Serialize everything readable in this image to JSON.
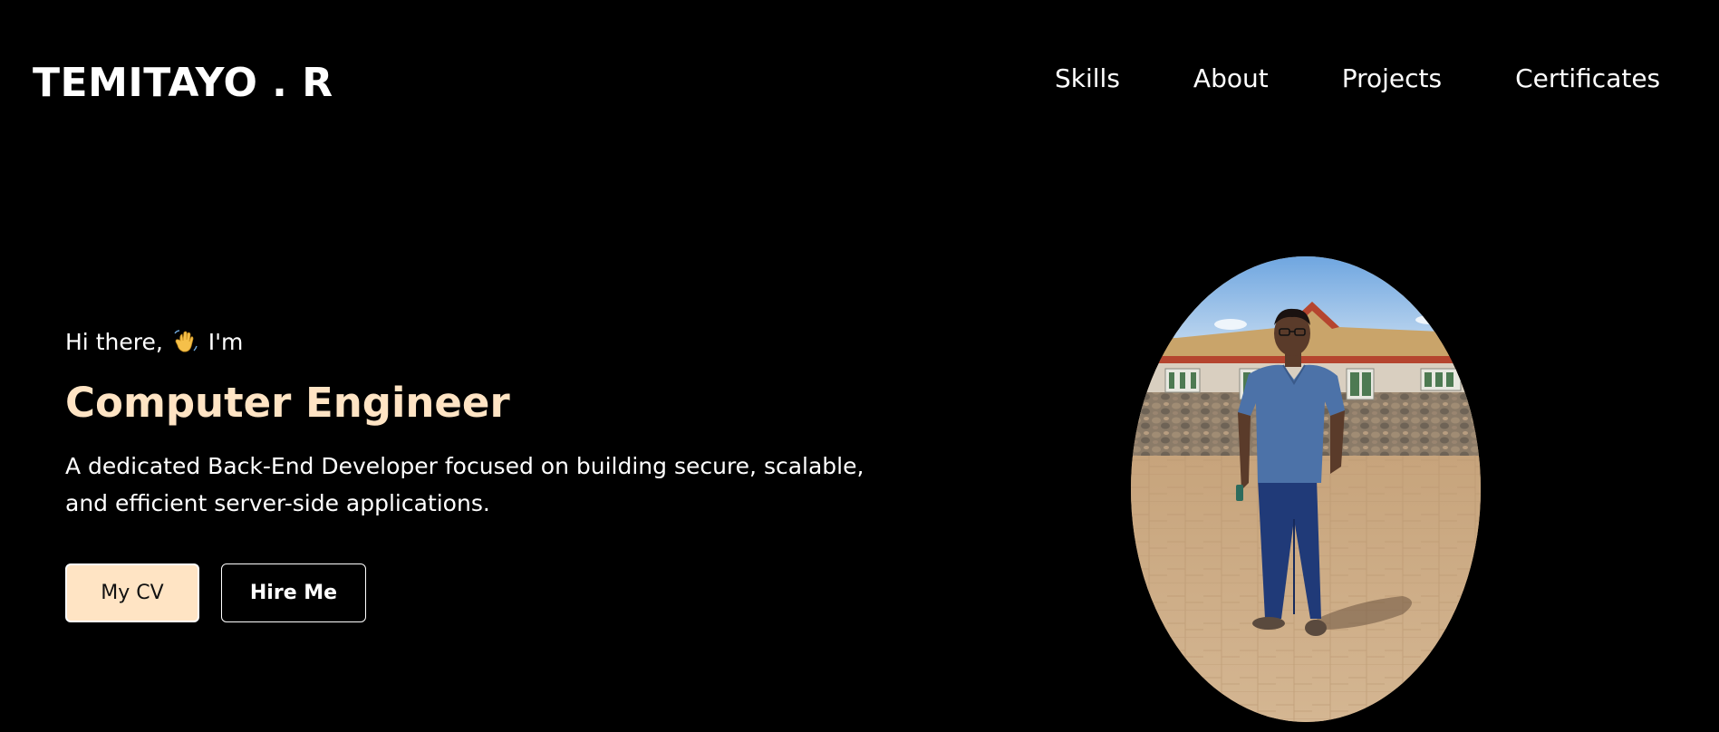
{
  "header": {
    "logo_text": "TEMITAYO . R",
    "nav": [
      {
        "label": "Skills"
      },
      {
        "label": "About"
      },
      {
        "label": "Projects"
      },
      {
        "label": "Certificates"
      }
    ]
  },
  "hero": {
    "greeting_prefix": "Hi there,",
    "greeting_suffix": "I'm",
    "greeting_icon": "waving-hand-icon",
    "title": "Computer Engineer",
    "description": "A dedicated Back-End Developer focused on building secure, scalable, and efficient server-side applications.",
    "buttons": {
      "cv_label": "My CV",
      "hire_label": "Hire Me"
    },
    "portrait": "profile-photo"
  },
  "colors": {
    "background": "#000000",
    "accent": "#ffe4c4",
    "text": "#ffffff"
  }
}
